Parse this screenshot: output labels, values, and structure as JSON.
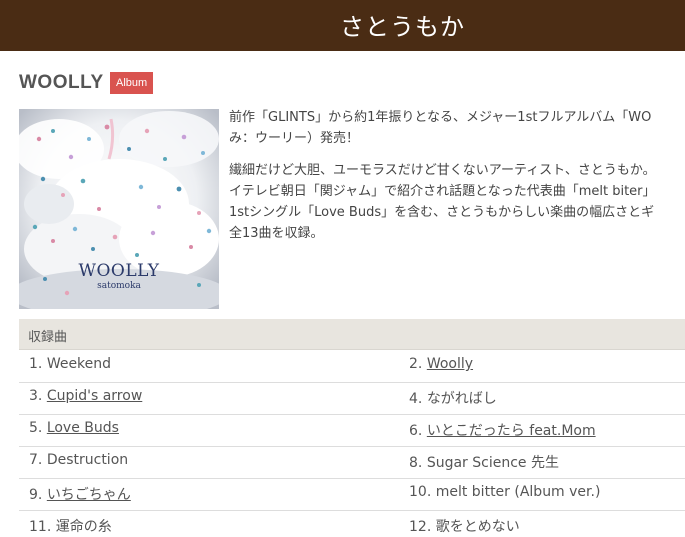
{
  "header": {
    "artist": "さとうもか"
  },
  "album": {
    "title": "WOOLLY",
    "badge": "Album",
    "cover_logo": "WOOLLY",
    "cover_sub": "satomoka"
  },
  "description": {
    "line1": "前作「GLINTS」から約1年振りとなる、メジャー1stフルアルバム「WO",
    "line2": "み：ウーリー）発売！",
    "line3": "繊細だけど大胆、ユーモラスだけど甘くないアーティスト、さとうもか。",
    "line4": "イテレビ朝日「関ジャム」で紹介され話題となった代表曲「melt biter」",
    "line5": "1stシングル「Love Buds」を含む、さとうもからしい楽曲の幅広さとギ",
    "line6": "全13曲を収録。"
  },
  "tracklist": {
    "heading": "収録曲",
    "rows": [
      {
        "left": {
          "num": "1.",
          "title": "Weekend"
        },
        "right": {
          "num": "2.",
          "title": "Woolly"
        }
      },
      {
        "left": {
          "num": "3.",
          "title": "Cupid's arrow"
        },
        "right": {
          "num": "4.",
          "title": "ながればし"
        }
      },
      {
        "left": {
          "num": "5.",
          "title": "Love Buds"
        },
        "right": {
          "num": "6.",
          "title": "いとこだったら feat.Mom"
        }
      },
      {
        "left": {
          "num": "7.",
          "title": "Destruction"
        },
        "right": {
          "num": "8.",
          "title": "Sugar Science 先生"
        }
      },
      {
        "left": {
          "num": "9.",
          "title": "いちごちゃん"
        },
        "right": {
          "num": "10.",
          "title": "melt bitter (Album ver.)"
        }
      },
      {
        "left": {
          "num": "11.",
          "title": "運命の糸"
        },
        "right": {
          "num": "12.",
          "title": "歌をとめない"
        }
      }
    ]
  },
  "colors": {
    "header_bg": "#4a2c14",
    "badge_bg": "#d9534f",
    "tracks_header_bg": "#e8e5df"
  }
}
